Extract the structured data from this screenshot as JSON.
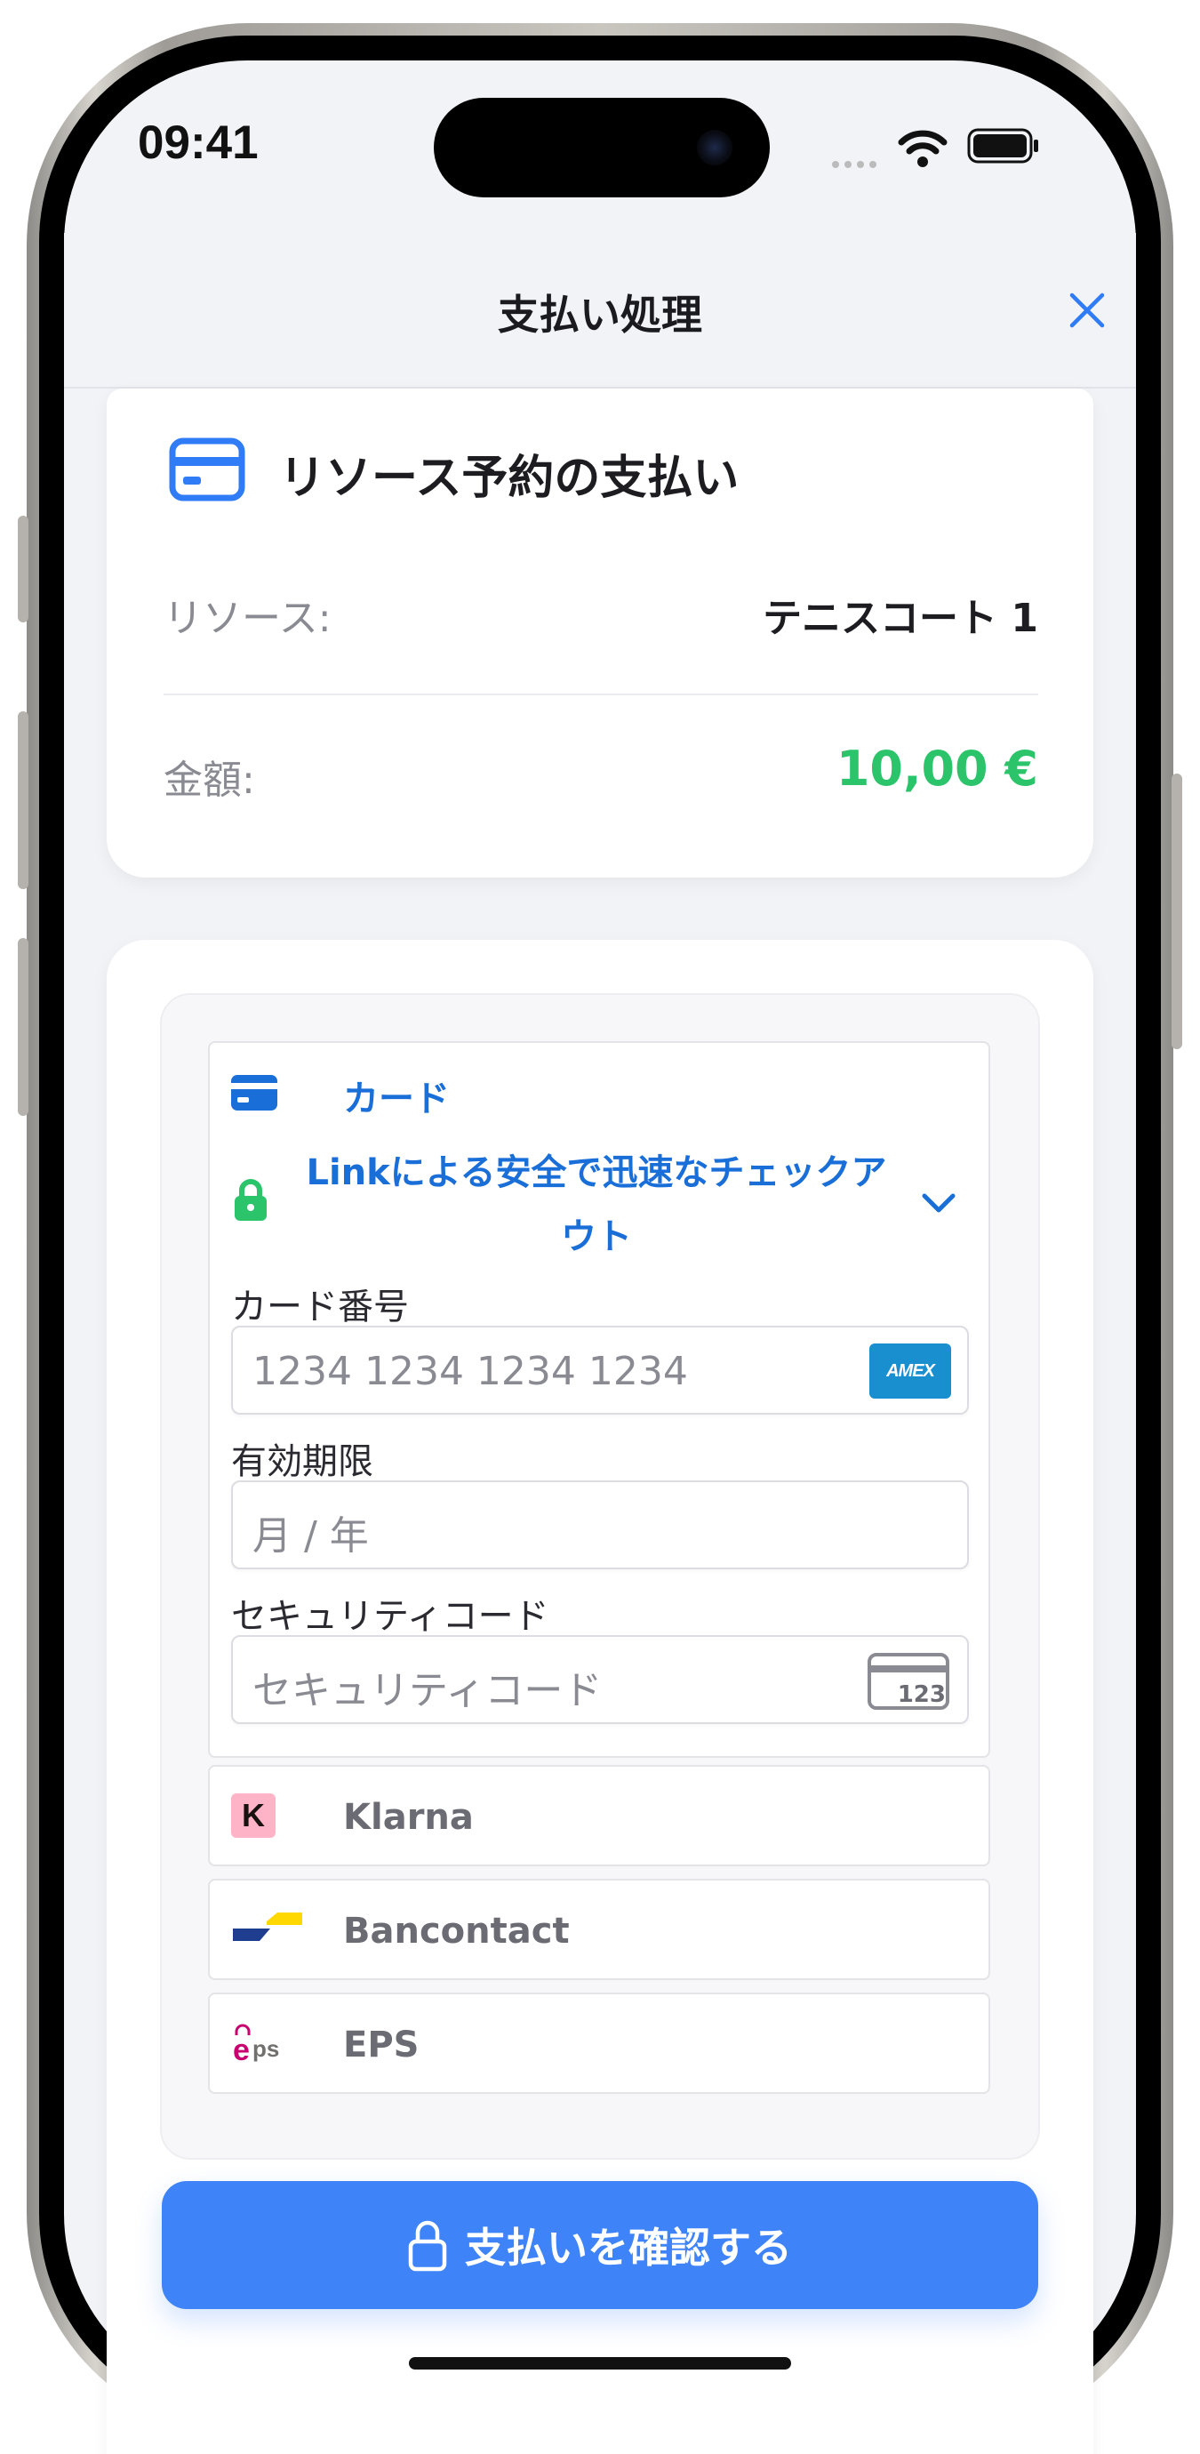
{
  "status_bar": {
    "time": "09:41"
  },
  "header": {
    "title": "支払い処理",
    "close_icon": "close-icon"
  },
  "summary": {
    "title": "リソース予約の支払い",
    "icon": "credit-card-icon",
    "resource_label": "リソース:",
    "resource_value": "テニスコート 1",
    "amount_label": "金額:",
    "amount_value": "10,00 €",
    "amount_color": "#2bc46a"
  },
  "payment": {
    "card_method_label": "カード",
    "link_text": "Linkによる安全で迅速なチェックアウト",
    "card_number_label": "カード番号",
    "card_number_placeholder": "1234 1234 1234 1234",
    "card_brand": "AMEX",
    "expiry_label": "有効期限",
    "expiry_placeholder": "月 / 年",
    "cvc_label": "セキュリティコード",
    "cvc_placeholder": "セキュリティコード",
    "cvc_icon_text": "123",
    "alt_methods": [
      {
        "label": "Klarna",
        "icon": "klarna-icon"
      },
      {
        "label": "Bancontact",
        "icon": "bancontact-icon"
      },
      {
        "label": "EPS",
        "icon": "eps-icon"
      }
    ]
  },
  "confirm_button": {
    "label": "支払いを確認する",
    "icon": "lock-icon",
    "color": "#3f83f8"
  },
  "colors": {
    "accent": "#1a6ed8",
    "link_lock": "#2bc46a"
  }
}
